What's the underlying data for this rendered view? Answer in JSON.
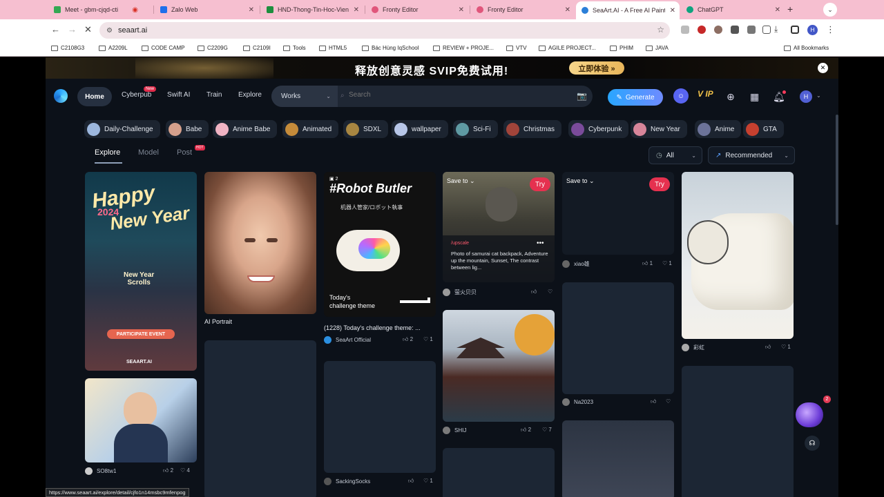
{
  "browser": {
    "tabs": [
      {
        "title": "Meet - gbm-cjqd-cti",
        "color": "#34a853"
      },
      {
        "title": "Zalo Web",
        "color": "#1f6feb"
      },
      {
        "title": "HND-Thong-Tin-Hoc-Vien",
        "color": "#1e8e3e"
      },
      {
        "title": "Fronty Editor",
        "color": "#e0567b"
      },
      {
        "title": "Fronty Editor",
        "color": "#e0567b"
      },
      {
        "title": "SeaArt.AI - A Free AI Paint",
        "color": "#2b7fd8"
      },
      {
        "title": "ChatGPT",
        "color": "#10a37f"
      }
    ],
    "url": "seaart.ai",
    "profile_initial": "H",
    "bookmarks": [
      "C2108G3",
      "A2209L",
      "CODE CAMP",
      "C2209G",
      "C2109I",
      "Tools",
      "HTML5",
      "Bác Hùng IqSchool",
      "REVIEW + PROJE...",
      "VTV",
      "AGILE PROJECT...",
      "PHIM",
      "JAVA"
    ],
    "all_bookmarks": "All Bookmarks",
    "status_url": "https://www.seaart.ai/explore/detail/cjfo1n14msbc9mfenpog"
  },
  "banner": {
    "text": "释放创意灵感  SVIP免费试用!",
    "button": "立即体验 »"
  },
  "header": {
    "nav": [
      "Home",
      "Cyberpub",
      "Swift AI",
      "Train",
      "Explore"
    ],
    "new_badge": "New",
    "search_scope": "Works",
    "search_placeholder": "Search",
    "generate": "Generate",
    "avatar_initial": "H"
  },
  "chips": [
    "Daily-Challenge",
    "Babe",
    "Anime Babe",
    "Animated",
    "SDXL",
    "wallpaper",
    "Sci-Fi",
    "Christmas",
    "Cyberpunk",
    "New Year",
    "Anime",
    "GTA"
  ],
  "filters": {
    "tabs": [
      "Explore",
      "Model",
      "Post"
    ],
    "hot_badge": "HOT",
    "time": "All",
    "sort": "Recommended"
  },
  "cards": {
    "newyear": {
      "user": "",
      "line1": "Happy",
      "line2": "2024",
      "line3": "New Year",
      "scrolls": "New Year\nScrolls",
      "cta": "PARTICIPATE EVENT",
      "brand": "SEAART.AI"
    },
    "portrait": {
      "title": "AI Portrait"
    },
    "robot": {
      "heading": "#Robot Butler",
      "sub": "机器人管家/ロボット執事",
      "today": "Today's\nchallenge theme",
      "count": "2",
      "title": "(1228) Today's challenge theme: ...",
      "user": "SeaArt Official",
      "likes": "2",
      "hearts": "1"
    },
    "cat": {
      "save": "Save to",
      "try": "Try",
      "tag": "/upscale",
      "desc": "Photo of samurai cat backpack, Adventure up the mountain, Sunset, The contrast between lig...",
      "user": "萤火贝贝",
      "likes": "",
      "hearts": ""
    },
    "blank1": {
      "save": "Save to",
      "try": "Try",
      "user": "xiao雄",
      "likes": "1",
      "hearts": "1"
    },
    "tiger": {
      "user": "彩虹",
      "likes": "",
      "hearts": "1"
    },
    "sobt": {
      "user": "SO8tw1",
      "likes": "2",
      "hearts": "4"
    },
    "pagoda": {
      "user": "SHIJ",
      "likes": "2",
      "hearts": "7"
    },
    "na": {
      "user": "Na2023",
      "likes": "",
      "hearts": ""
    },
    "sacking": {
      "user": "SackingSocks",
      "likes": "",
      "hearts": "1"
    }
  },
  "orb_badge": "2"
}
